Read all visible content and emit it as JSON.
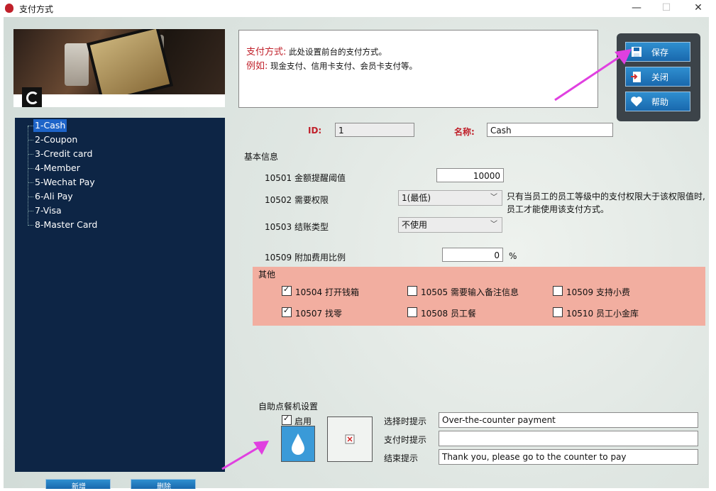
{
  "window": {
    "title": "支付方式",
    "min": "—",
    "max": "☐",
    "close": "✕"
  },
  "tree": {
    "items": [
      "1-Cash",
      "2-Coupon",
      "3-Credit card",
      "4-Member",
      "5-Wechat Pay",
      "6-Ali Pay",
      "7-Visa",
      "8-Master Card"
    ],
    "selected": 0
  },
  "description": {
    "label1": "支付方式:",
    "text1": "此处设置前台的支付方式。",
    "label2": "例如:",
    "text2": "现金支付、信用卡支付、会员卡支付等。"
  },
  "actions": {
    "save": "保存",
    "close": "关闭",
    "help": "帮助"
  },
  "record": {
    "id_label": "ID:",
    "id_value": "1",
    "name_label": "名称:",
    "name_value": "Cash"
  },
  "basic": {
    "section": "基本信息",
    "f10501_label": "10501 金额提醒阈值",
    "f10501_value": "10000",
    "f10502_label": "10502 需要权限",
    "f10502_value": "1(最低)",
    "f10502_note1": "只有当员工的员工等级中的支付权限大于该权限值时,",
    "f10502_note2": "员工才能使用该支付方式。",
    "f10503_label": "10503 结账类型",
    "f10503_value": "不使用",
    "f10509_label": "10509 附加费用比例",
    "f10509_value": "0",
    "f10509_unit": "%"
  },
  "other": {
    "section": "其他",
    "c10504": "10504 打开钱箱",
    "c10505": "10505 需要输入备注信息",
    "c10509": "10509 支持小费",
    "c10507": "10507 找零",
    "c10508": "10508 员工餐",
    "c10510": "10510 员工小金库"
  },
  "kiosk": {
    "section": "自助点餐机设置",
    "enable": "启用",
    "select_label": "选择时提示",
    "select_value": "Over-the-counter payment",
    "pay_label": "支付时提示",
    "pay_value": "",
    "end_label": "结束提示",
    "end_value": "Thank you, please go to the counter to pay"
  },
  "footer": {
    "add": "新增",
    "delete": "删除"
  },
  "colors": {
    "accent": "#1e64c8",
    "tree_bg": "#0d2545",
    "other_bg": "#f2aea0",
    "arrow": "#e040e0"
  }
}
